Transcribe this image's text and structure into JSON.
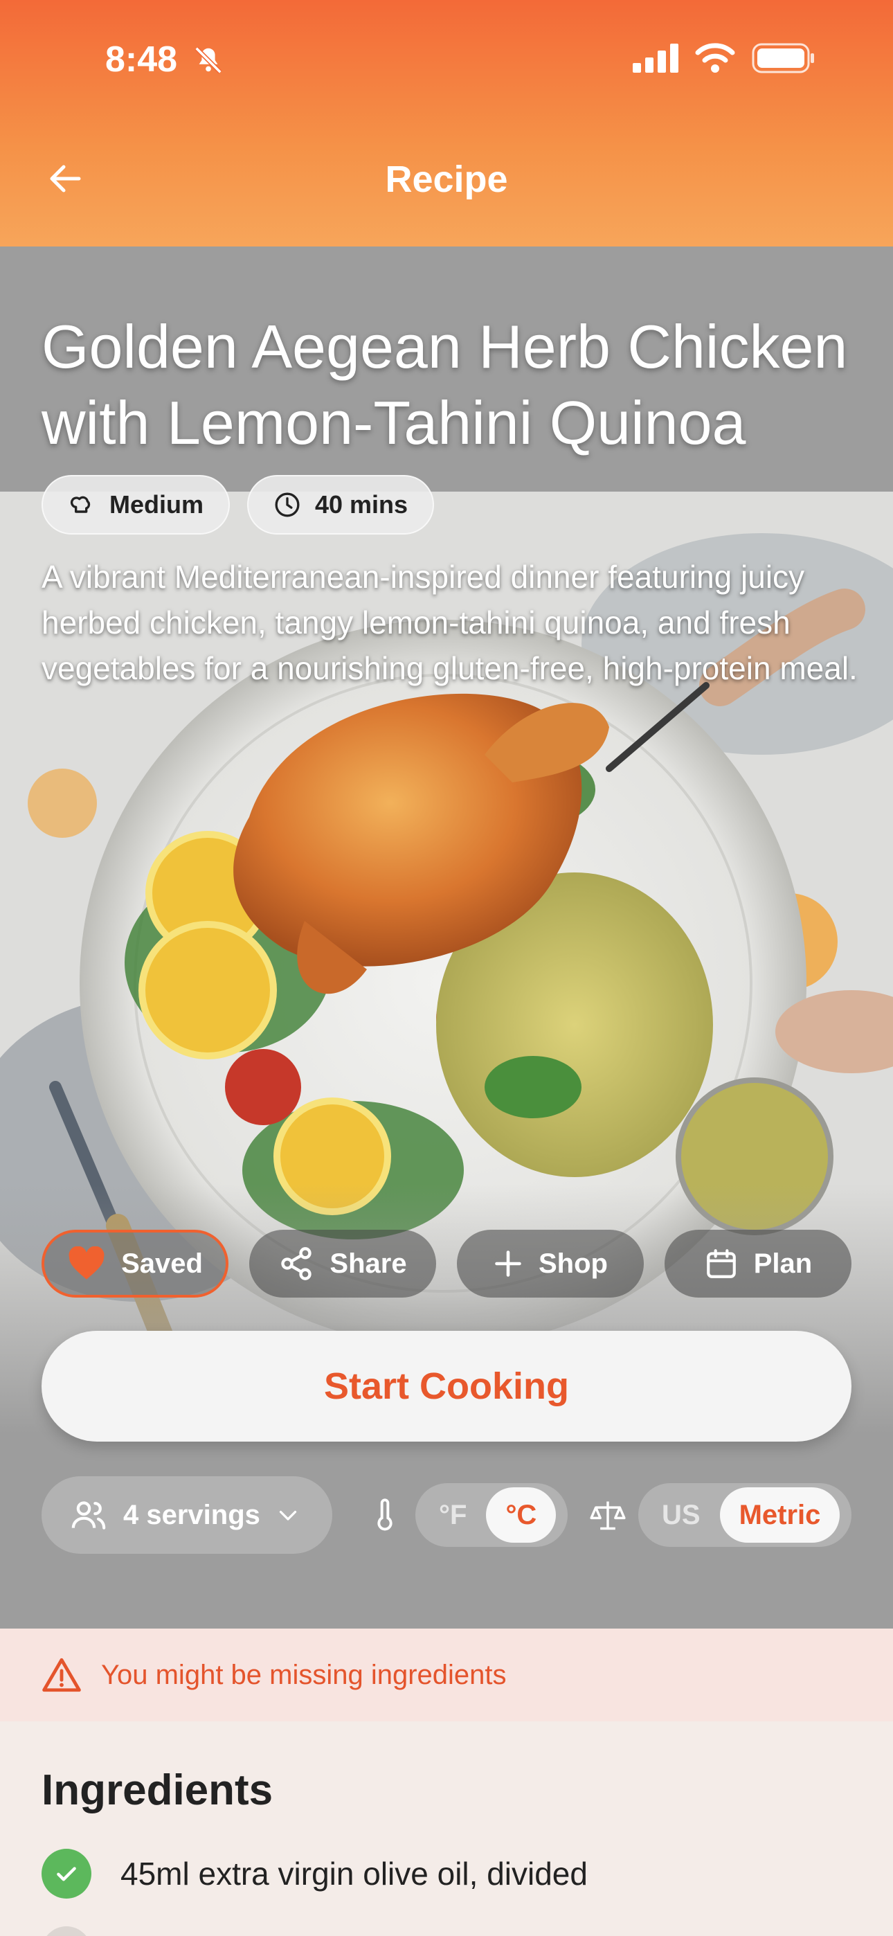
{
  "status": {
    "time": "8:48"
  },
  "header": {
    "title": "Recipe"
  },
  "recipe": {
    "title": "Golden Aegean Herb Chicken with Lemon-Tahini Quinoa",
    "difficulty": "Medium",
    "time": "40 mins",
    "description": "A vibrant Mediterranean-inspired dinner featuring juicy herbed chicken, tangy lemon-tahini quinoa, and fresh vegetables for a nourishing gluten-free, high-protein meal."
  },
  "actions": {
    "saved": "Saved",
    "share": "Share",
    "shop": "Shop",
    "plan": "Plan"
  },
  "start_cooking": "Start Cooking",
  "controls": {
    "servings": "4 servings",
    "temp_options": [
      "°F",
      "°C"
    ],
    "temp_selected": "°C",
    "unit_options": [
      "US",
      "Metric"
    ],
    "unit_selected": "Metric"
  },
  "warning": "You might be missing ingredients",
  "ingredients": {
    "heading": "Ingredients",
    "items": [
      {
        "text": "45ml extra virgin olive oil, divided",
        "checked": true
      }
    ]
  },
  "colors": {
    "accent": "#e8582c",
    "header_top": "#f36a38",
    "header_bottom": "#f7a55a",
    "check": "#5cb85c"
  }
}
